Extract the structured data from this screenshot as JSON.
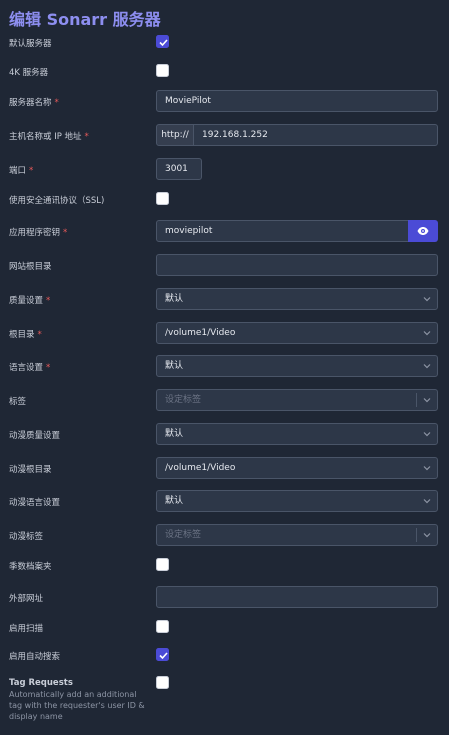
{
  "title": "编辑 Sonarr 服务器",
  "fields": {
    "default_server": {
      "label": "默认服务器"
    },
    "server_4k": {
      "label": "4K 服务器"
    },
    "server_name": {
      "label": "服务器名称",
      "value": "MoviePilot"
    },
    "hostname": {
      "label": "主机名称或 IP 地址",
      "prefix": "http://",
      "value": "192.168.1.252"
    },
    "port": {
      "label": "端口",
      "value": "3001"
    },
    "ssl": {
      "label": "使用安全通讯协议（SSL)"
    },
    "api_key": {
      "label": "应用程序密钥",
      "value": "moviepilot"
    },
    "base_url": {
      "label": "网站根目录",
      "value": ""
    },
    "quality": {
      "label": "质量设置",
      "value": "默认"
    },
    "root_folder": {
      "label": "根目录",
      "value": "/volume1/Video"
    },
    "language": {
      "label": "语言设置",
      "value": "默认"
    },
    "tags": {
      "label": "标签",
      "placeholder": "设定标签"
    },
    "anime_quality": {
      "label": "动漫质量设置",
      "value": "默认"
    },
    "anime_root": {
      "label": "动漫根目录",
      "value": "/volume1/Video"
    },
    "anime_language": {
      "label": "动漫语言设置",
      "value": "默认"
    },
    "anime_tags": {
      "label": "动漫标签",
      "placeholder": "设定标签"
    },
    "season_folders": {
      "label": "季数档案夹"
    },
    "external_url": {
      "label": "外部网址",
      "value": ""
    },
    "enable_scan": {
      "label": "启用扫描"
    },
    "auto_search": {
      "label": "启用自动搜索"
    },
    "tag_requests": {
      "label": "Tag Requests",
      "description": "Automatically add an additional tag with the requester's user ID & display name"
    }
  },
  "checkbox_states": {
    "default_server": true,
    "server_4k": false,
    "ssl": false,
    "season_folders": false,
    "enable_scan": false,
    "auto_search": true,
    "tag_requests": false
  },
  "colors": {
    "accent": "#4b4bd6",
    "title": "#8d8ef0",
    "required": "#ea5a5a",
    "background": "#1f2735"
  },
  "icons": {
    "show_password": "eye-icon",
    "dropdown": "chevron-down-icon",
    "check": "checkmark-icon"
  }
}
